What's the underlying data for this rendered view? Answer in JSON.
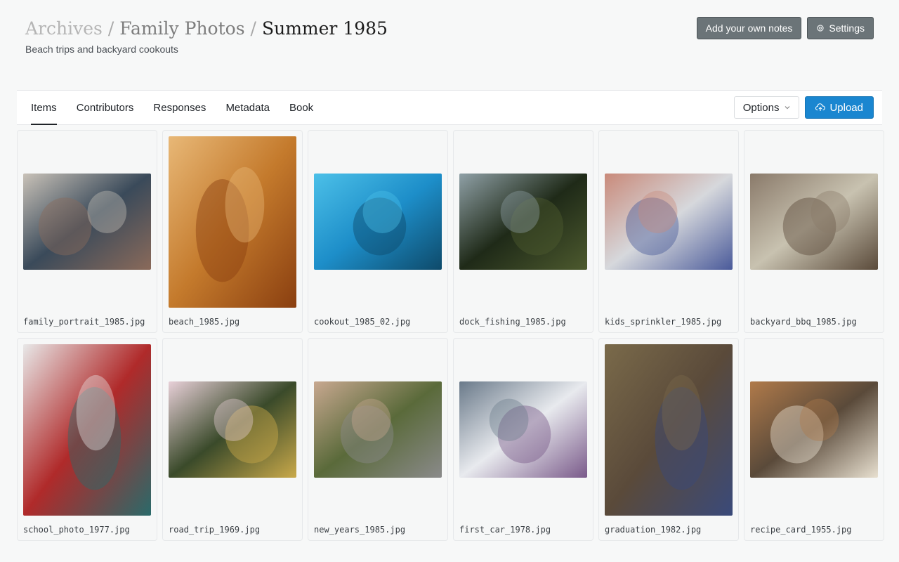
{
  "header": {
    "breadcrumb": [
      "Archives",
      "Family Photos",
      "Summer 1985"
    ],
    "separator": "/",
    "subtitle": "Beach trips and backyard cookouts",
    "notes_button": "Add your own notes",
    "settings_button": "Settings"
  },
  "tabs": [
    {
      "label": "Items",
      "active": true
    },
    {
      "label": "Contributors",
      "active": false
    },
    {
      "label": "Responses",
      "active": false
    },
    {
      "label": "Metadata",
      "active": false
    },
    {
      "label": "Book",
      "active": false
    }
  ],
  "toolbar": {
    "options_label": "Options",
    "upload_label": "Upload"
  },
  "items": [
    {
      "filename": "family_portrait_1985.jpg",
      "orientation": "landscape",
      "palette": [
        "#3a4a5a",
        "#8a6a5a",
        "#c9c2b8"
      ]
    },
    {
      "filename": "beach_1985.jpg",
      "orientation": "portrait",
      "palette": [
        "#c47a2c",
        "#8a3f10",
        "#e8b877"
      ]
    },
    {
      "filename": "cookout_1985_02.jpg",
      "orientation": "landscape",
      "palette": [
        "#1d8ec9",
        "#0e4a6a",
        "#4cc0e8"
      ]
    },
    {
      "filename": "dock_fishing_1985.jpg",
      "orientation": "landscape",
      "palette": [
        "#1f2a18",
        "#4d5a2e",
        "#8fa0a6"
      ]
    },
    {
      "filename": "kids_sprinkler_1985.jpg",
      "orientation": "landscape",
      "palette": [
        "#d6d8dc",
        "#4a5a9a",
        "#c98a7a"
      ]
    },
    {
      "filename": "backyard_bbq_1985.jpg",
      "orientation": "landscape",
      "palette": [
        "#c8c2b0",
        "#5a4a3a",
        "#8a7a6a"
      ]
    },
    {
      "filename": "school_photo_1977.jpg",
      "orientation": "portrait",
      "palette": [
        "#b02a2a",
        "#2a6a6a",
        "#e8e8e8"
      ]
    },
    {
      "filename": "road_trip_1969.jpg",
      "orientation": "landscape",
      "palette": [
        "#3a4a2a",
        "#c9a94a",
        "#e8d0d8"
      ]
    },
    {
      "filename": "new_years_1985.jpg",
      "orientation": "landscape",
      "palette": [
        "#5a6a3a",
        "#8a8a8a",
        "#c8a890"
      ]
    },
    {
      "filename": "first_car_1978.jpg",
      "orientation": "landscape",
      "palette": [
        "#e8eaee",
        "#7a5a8a",
        "#6a7a8a"
      ]
    },
    {
      "filename": "graduation_1982.jpg",
      "orientation": "portrait",
      "palette": [
        "#5a4a3a",
        "#3a4a7a",
        "#7a6a4a"
      ]
    },
    {
      "filename": "recipe_card_1955.jpg",
      "orientation": "landscape",
      "palette": [
        "#5a4a3a",
        "#e8e0d0",
        "#b07a4a"
      ]
    }
  ],
  "icons": {
    "settings": "gear-icon",
    "options": "chevron-down-icon",
    "upload": "cloud-upload-icon"
  },
  "colors": {
    "upload_button": "#1a86d0",
    "header_button": "#6b7478"
  }
}
